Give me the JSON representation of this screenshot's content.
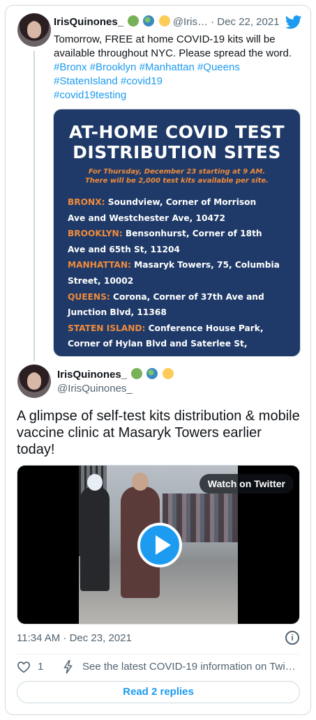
{
  "parent_tweet": {
    "name": "IrisQuinones_",
    "handle": "@Iris…",
    "date": "· Dec 22, 2021",
    "text_line1": "Tomorrow, FREE at home COVID-19 kits will be",
    "text_line2": "available throughout NYC. Please spread the word.",
    "hashtags_line1": "#Bronx #Brooklyn #Manhattan #Queens",
    "hashtags_line2": "#StatenIsland #covid19",
    "hashtags_line3": "#covid19testing",
    "flyer": {
      "title_line1": "AT-HOME COVID TEST",
      "title_line2": "DISTRIBUTION SITES",
      "subtitle_line1": "For Thursday, December 23 starting at 9 AM.",
      "subtitle_line2": "There will be 2,000 test kits available per site.",
      "sites": [
        {
          "boro": "BRONX:",
          "line1": " Soundview, Corner of Morrison",
          "line2": "Ave and Westchester Ave, 10472"
        },
        {
          "boro": "BROOKLYN:",
          "line1": " Bensonhurst, Corner of 18th",
          "line2": "Ave and 65th St, 11204"
        },
        {
          "boro": "MANHATTAN:",
          "line1": " Masaryk Towers, 75, Columbia",
          "line2": "Street, 10002"
        },
        {
          "boro": "QUEENS:",
          "line1": " Corona, Corner of 37th Ave and",
          "line2": "Junction Blvd, 11368"
        },
        {
          "boro": "STATEN ISLAND:",
          "line1": " Conference House Park,",
          "line2": "Corner of Hylan Blvd and Saterlee St,"
        }
      ]
    }
  },
  "main_tweet": {
    "name": "IrisQuinones_",
    "handle": "@IrisQuinones_",
    "text": "A glimpse of self-test kits distribution & mobile vaccine clinic at Masaryk Towers earlier today!",
    "video": {
      "watch_label": "Watch on Twitter"
    },
    "timestamp": "11:34 AM · Dec 23, 2021",
    "info_icon": "i",
    "like_count": "1",
    "covid_link": "See the latest COVID-19 information on Twi…",
    "replies_button": "Read 2 replies"
  },
  "colors": {
    "accent": "#1d9bf0",
    "flyer_bg": "#1f3a68",
    "flyer_orange": "#f08b3c",
    "muted": "#536471"
  },
  "icons": [
    "twitter-bird-icon",
    "green-heart-icon",
    "globe-icon",
    "yellow-heart-icon",
    "play-icon",
    "info-icon",
    "heart-icon",
    "lightning-bolt-icon"
  ]
}
